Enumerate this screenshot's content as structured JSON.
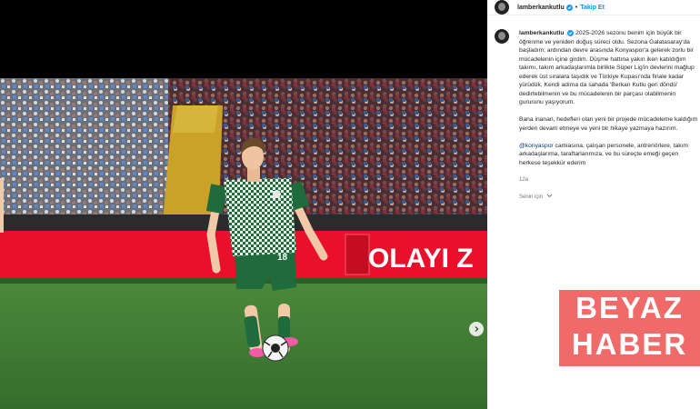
{
  "post": {
    "username": "lamberkankutlu",
    "follow_label": "Takip Et",
    "separator": "•",
    "caption_paragraphs": [
      "2025-2026 sezonu benim için büyük bir öğrenme ve yeniden doğuş süreci oldu. Sezona Galatasaray'da başladım; ardından devre arasında Konyaspor'a gelerek zorlu bir mücadelenin içine girdim. Düşme hattına yakın iken katıldığım takımı, takım arkadaşlarımla birlikte Süper Lig'in devlerini mağlup ederek üst sıralara taşıdık ve Türkiye Kupası'nda finale kadar yürüdük. Kendi adıma da sahada 'Berkan Kutlu geri döndü' dedirtebilmenin ve bu mücadelenin bir parçası olabilmenin gururunu yaşıyorum.",
      "Bana inanan, hedefleri olan yeni bir projede mücadeleme kaldığım yerden devam etmeye ve yeni bir hikaye yazmaya hazırım."
    ],
    "closing_mention": "@konyaspor",
    "closing_text": " camiasına, çalışan personele, antrenörlere, takım arkadaşlarıma, taraftarlarımıza, ve bu süreçte emeği geçen herkese teşekkür ederim",
    "time_ago": "12a",
    "translate_label": "Senin için"
  },
  "photo": {
    "board_text": "OLAYI  Z",
    "shirt_number": "18"
  },
  "watermark": {
    "line1": "BEYAZ",
    "line2": "HABER"
  },
  "colors": {
    "link": "#0095f6",
    "mention": "#00376b",
    "verified": "#1d9bf0",
    "board_red": "#e8102a",
    "pitch_green": "#3f7d34",
    "kit_green": "#1f6b3c",
    "watermark": "#ee5555"
  }
}
